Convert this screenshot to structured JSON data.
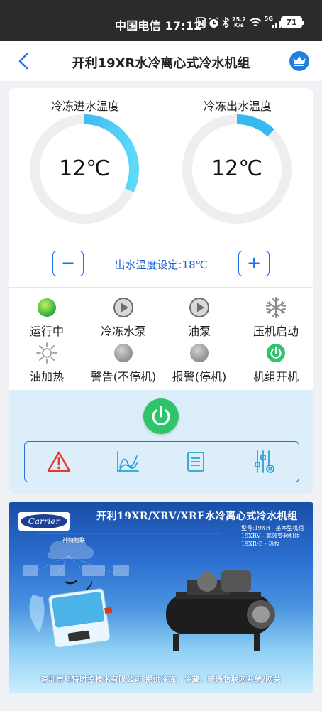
{
  "status_bar": {
    "carrier_time": "中国电信 17:12",
    "net_speed_value": "25.2",
    "net_speed_unit": "K/s",
    "signal_label": "5G",
    "battery": "71"
  },
  "header": {
    "title": "开利19XR水冷离心式冷水机组"
  },
  "gauges": [
    {
      "label": "冷冻进水温度",
      "value": "12℃",
      "fraction": 0.32
    },
    {
      "label": "冷冻出水温度",
      "value": "12℃",
      "fraction": 0.12
    }
  ],
  "setpoint": {
    "minus_label": "−",
    "plus_label": "+",
    "text": "出水温度设定:18℃"
  },
  "status_items": [
    {
      "label": "运行中",
      "icon": "green-indicator-icon"
    },
    {
      "label": "冷冻水泵",
      "icon": "pump-play-icon"
    },
    {
      "label": "油泵",
      "icon": "pump-play-icon"
    },
    {
      "label": "压机启动",
      "icon": "snowflake-icon"
    },
    {
      "label": "油加热",
      "icon": "sun-icon"
    },
    {
      "label": "警告(不停机)",
      "icon": "gray-indicator-icon"
    },
    {
      "label": "报警(停机)",
      "icon": "gray-indicator-icon"
    },
    {
      "label": "机组开机",
      "icon": "power-icon"
    }
  ],
  "toolbar": {
    "items": [
      "alarm-icon",
      "chart-icon",
      "list-icon",
      "settings-sliders-icon"
    ]
  },
  "banner": {
    "logo_text": "Carrier",
    "title": "开利19XR/XRV/XRE水冷离心式冷水机组",
    "model_lines": [
      "型号:19XR - 基本型机组",
      "19XRV - 高效变频机组",
      "19XR-E - 热泵"
    ],
    "cloud_label": "神特物联",
    "footer": "深圳市科特时控技术有限公司   提供冷冻、冷藏、暖通物联网系统/网关"
  },
  "colors": {
    "accent": "#1a73e8",
    "gauge_track": "#eeeeee",
    "gauge_arc": "#34b9f0",
    "running_green": "#2ec46a",
    "panel_bg": "#dbeefa",
    "alarm_red": "#e53935"
  }
}
